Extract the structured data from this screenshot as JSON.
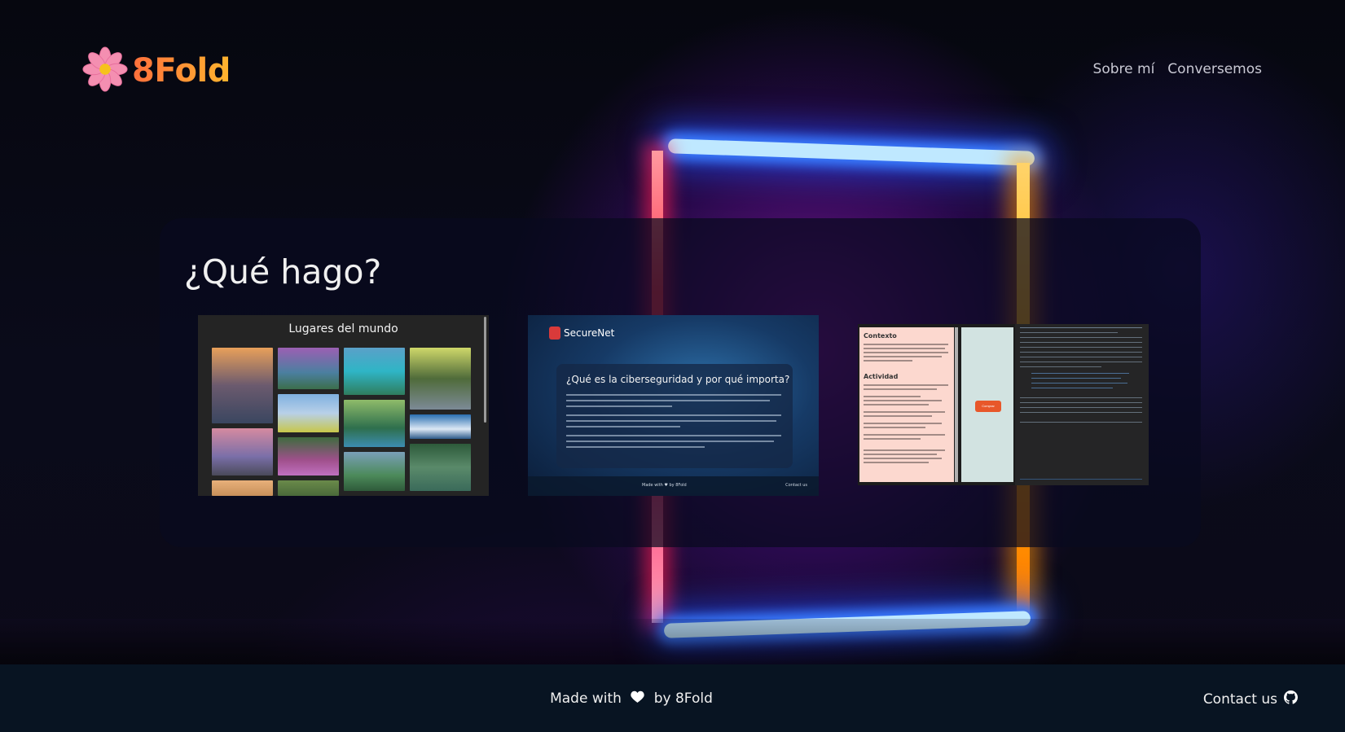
{
  "header": {
    "logo_text": "8Fold",
    "nav": [
      "Sobre mí",
      "Conversemos"
    ]
  },
  "main": {
    "title": "¿Qué hago?",
    "projects": [
      {
        "name": "Lugares del mundo"
      },
      {
        "name": "SecureNet",
        "headline": "¿Qué es la ciberseguridad y por qué importa?",
        "footer_made": "Made with ♥ by 8Fold",
        "footer_contact": "Contact us"
      },
      {
        "heading1": "Contexto",
        "heading2": "Actividad",
        "button": "Comprar"
      }
    ]
  },
  "footer": {
    "made_prefix": "Made with",
    "made_suffix": "by 8Fold",
    "contact": "Contact us"
  },
  "colors": {
    "logo_gradient": [
      "#ff6f3c",
      "#ffb52e"
    ],
    "footer_bg": "#081422",
    "panel_bg": "rgba(8,10,30,0.72)"
  },
  "icons": [
    "flower-logo-icon",
    "heart-icon",
    "github-icon",
    "lock-icon"
  ]
}
